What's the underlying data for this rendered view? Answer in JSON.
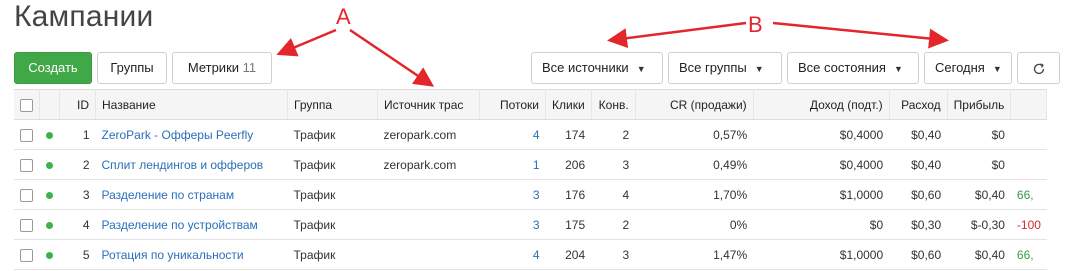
{
  "page": {
    "title": "Кампании"
  },
  "annotations": {
    "a": "A",
    "b": "B"
  },
  "colors": {
    "annotation": "#e3262c",
    "primary_button": "#41a847",
    "link": "#2a6fb9",
    "status_active": "#3cb34a"
  },
  "toolbar": {
    "create_label": "Создать",
    "groups_label": "Группы",
    "metrics_label": "Метрики",
    "metrics_count": "11",
    "sources_filter": "Все источники",
    "groups_filter": "Все группы",
    "states_filter": "Все состояния",
    "date_filter": "Сегодня",
    "refresh_icon": "refresh-icon"
  },
  "table": {
    "headers": {
      "id": "ID",
      "name": "Название",
      "group": "Группа",
      "source": "Источник трас",
      "flows": "Потоки",
      "clicks": "Клики",
      "conv": "Конв.",
      "cr": "CR (продажи)",
      "revenue": "Доход (подт.)",
      "cost": "Расход",
      "profit": "Прибыль"
    },
    "rows": [
      {
        "id": "1",
        "name": "ZeroPark - Офферы Peerfly",
        "group": "Трафик",
        "source": "zeropark.com",
        "flows": "4",
        "clicks": "174",
        "conv": "2",
        "cr": "0,57%",
        "revenue": "$0,4000",
        "cost": "$0,40",
        "profit": "$0",
        "extra": ""
      },
      {
        "id": "2",
        "name": "Сплит лендингов и офферов",
        "group": "Трафик",
        "source": "zeropark.com",
        "flows": "1",
        "clicks": "206",
        "conv": "3",
        "cr": "0,49%",
        "revenue": "$0,4000",
        "cost": "$0,40",
        "profit": "$0",
        "extra": ""
      },
      {
        "id": "3",
        "name": "Разделение по странам",
        "group": "Трафик",
        "source": "",
        "flows": "3",
        "clicks": "176",
        "conv": "4",
        "cr": "1,70%",
        "revenue": "$1,0000",
        "cost": "$0,60",
        "profit": "$0,40",
        "extra": "66,"
      },
      {
        "id": "4",
        "name": "Разделение по устройствам",
        "group": "Трафик",
        "source": "",
        "flows": "3",
        "clicks": "175",
        "conv": "2",
        "cr": "0%",
        "revenue": "$0",
        "cost": "$0,30",
        "profit": "$-0,30",
        "extra": "-100"
      },
      {
        "id": "5",
        "name": "Ротация по уникальности",
        "group": "Трафик",
        "source": "",
        "flows": "4",
        "clicks": "204",
        "conv": "3",
        "cr": "1,47%",
        "revenue": "$1,0000",
        "cost": "$0,60",
        "profit": "$0,40",
        "extra": "66,"
      }
    ]
  }
}
